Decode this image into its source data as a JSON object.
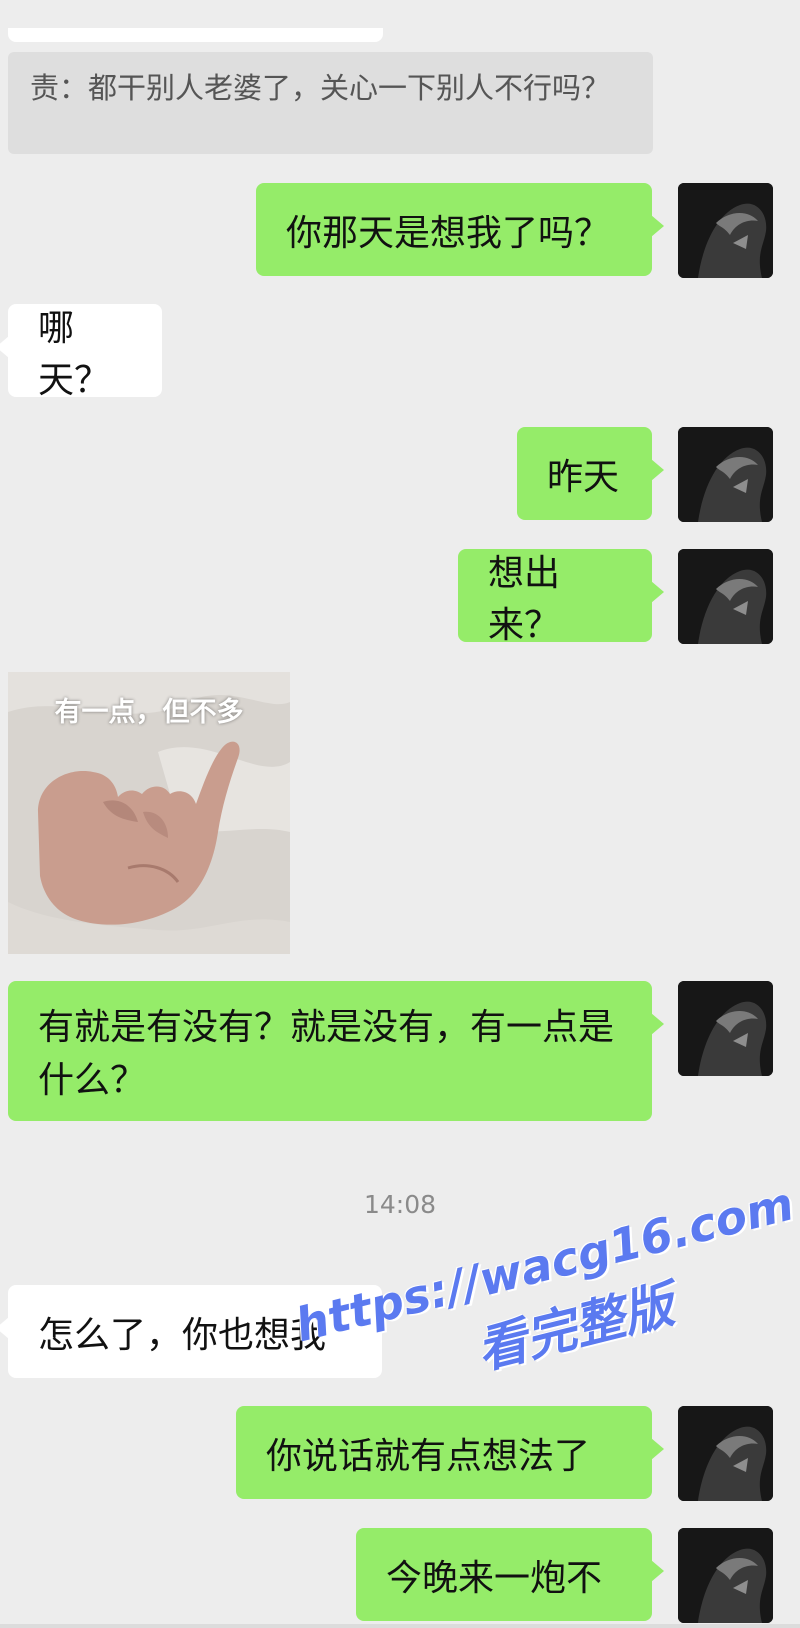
{
  "quote": "责：都干别人老婆了，关心一下别人不行吗？",
  "messages": {
    "m1": "你那天是想我了吗？",
    "m2": "哪天？",
    "m3": "昨天",
    "m4": "想出来？",
    "m5": "有就是有没有？就是没有，有一点是什么？",
    "m6": "怎么了，你也想我",
    "m7": "你说话就有点想法了",
    "m8": "今晚来一炮不"
  },
  "sticker_caption": "有一点，但不多",
  "timestamp": "14:08",
  "watermark": {
    "url": "https://wacg16.com",
    "sub": "看完整版"
  },
  "colors": {
    "background": "#ededed",
    "my_bubble": "#95ec69",
    "their_bubble": "#ffffff",
    "quote_bubble": "#dedede",
    "watermark": "#5b7af0"
  }
}
